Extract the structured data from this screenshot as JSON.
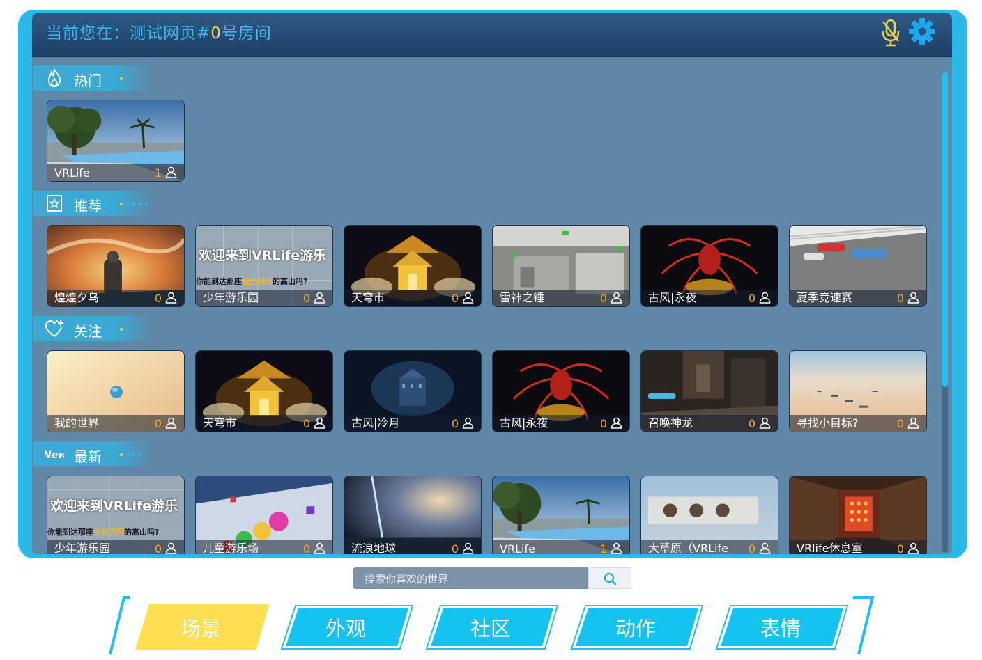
{
  "header": {
    "title_prefix": "当前您在：测试网页#",
    "title_num": "0",
    "title_suffix": "号房间",
    "mic_icon": "microphone-muted-icon",
    "settings_icon": "gear-icon"
  },
  "sections": [
    {
      "label": "热门",
      "icon": "fire-icon",
      "cards": [
        {
          "name": "VRLife",
          "count": "1"
        }
      ]
    },
    {
      "label": "推荐",
      "icon": "star-bookmark-icon",
      "cards": [
        {
          "name": "煌煌夕乌",
          "count": "0"
        },
        {
          "name": "少年游乐园",
          "count": "0",
          "banner": "欢迎来到VRLife游乐",
          "sub1": "你能到达那座",
          "sub2": "金光闪闪",
          "sub3": "的高山吗?"
        },
        {
          "name": "天穹市",
          "count": "0"
        },
        {
          "name": "雷神之锤",
          "count": "0"
        },
        {
          "name": "古风|永夜",
          "count": "0"
        },
        {
          "name": "夏季竞速赛",
          "count": "0"
        }
      ]
    },
    {
      "label": "关注",
      "icon": "heart-plus-icon",
      "cards": [
        {
          "name": "我的世界",
          "count": "0"
        },
        {
          "name": "天穹市",
          "count": "0"
        },
        {
          "name": "古风|冷月",
          "count": "0"
        },
        {
          "name": "古风|永夜",
          "count": "0"
        },
        {
          "name": "召唤神龙",
          "count": "0"
        },
        {
          "name": "寻找小目标?",
          "count": "0"
        }
      ]
    },
    {
      "label": "最新",
      "icon": "new-badge-icon",
      "badge": "New",
      "cards": [
        {
          "name": "少年游乐园",
          "count": "0",
          "banner": "欢迎来到VRLife游乐",
          "sub1": "你能到达那座",
          "sub2": "金光闪闪",
          "sub3": "的高山吗?"
        },
        {
          "name": "儿童游乐场",
          "count": "0"
        },
        {
          "name": "流浪地球",
          "count": "0"
        },
        {
          "name": "VRLife",
          "count": "1"
        },
        {
          "name": "大草原（VRLife",
          "count": "0"
        },
        {
          "name": "VRlife休息室",
          "count": "0"
        }
      ]
    }
  ],
  "search": {
    "placeholder": "搜索你喜欢的世界",
    "icon": "search-icon"
  },
  "tabs": [
    {
      "label": "场景",
      "active": true
    },
    {
      "label": "外观",
      "active": false
    },
    {
      "label": "社区",
      "active": false
    },
    {
      "label": "动作",
      "active": false
    },
    {
      "label": "表情",
      "active": false
    }
  ],
  "colors": {
    "accent": "#22bff0",
    "active_tab": "#ffdf4f",
    "title_text": "#3fb6ea",
    "count_text": "#f5a623"
  }
}
